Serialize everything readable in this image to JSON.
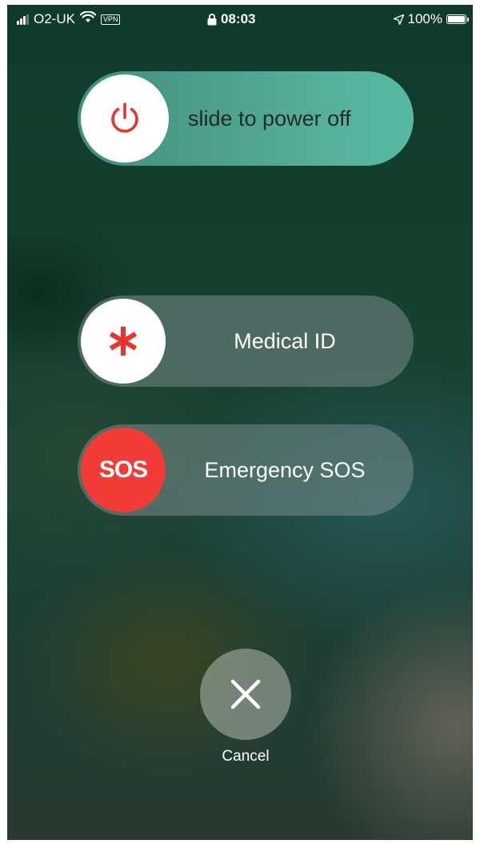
{
  "status_bar": {
    "carrier": "O2-UK",
    "vpn": "VPN",
    "time": "08:03",
    "battery_percent": "100%",
    "signal_bars_active": 3,
    "signal_bars_total": 4,
    "battery_level": 1.0
  },
  "power_slider": {
    "label": "slide to power off",
    "icon": "power-icon",
    "icon_color": "#e8332e"
  },
  "medical_slider": {
    "label": "Medical ID",
    "icon": "asterisk-icon",
    "icon_color": "#e8332e"
  },
  "sos_slider": {
    "label": "Emergency SOS",
    "knob_text": "SOS",
    "knob_color": "#f03b36"
  },
  "cancel": {
    "label": "Cancel",
    "icon": "close-icon"
  }
}
